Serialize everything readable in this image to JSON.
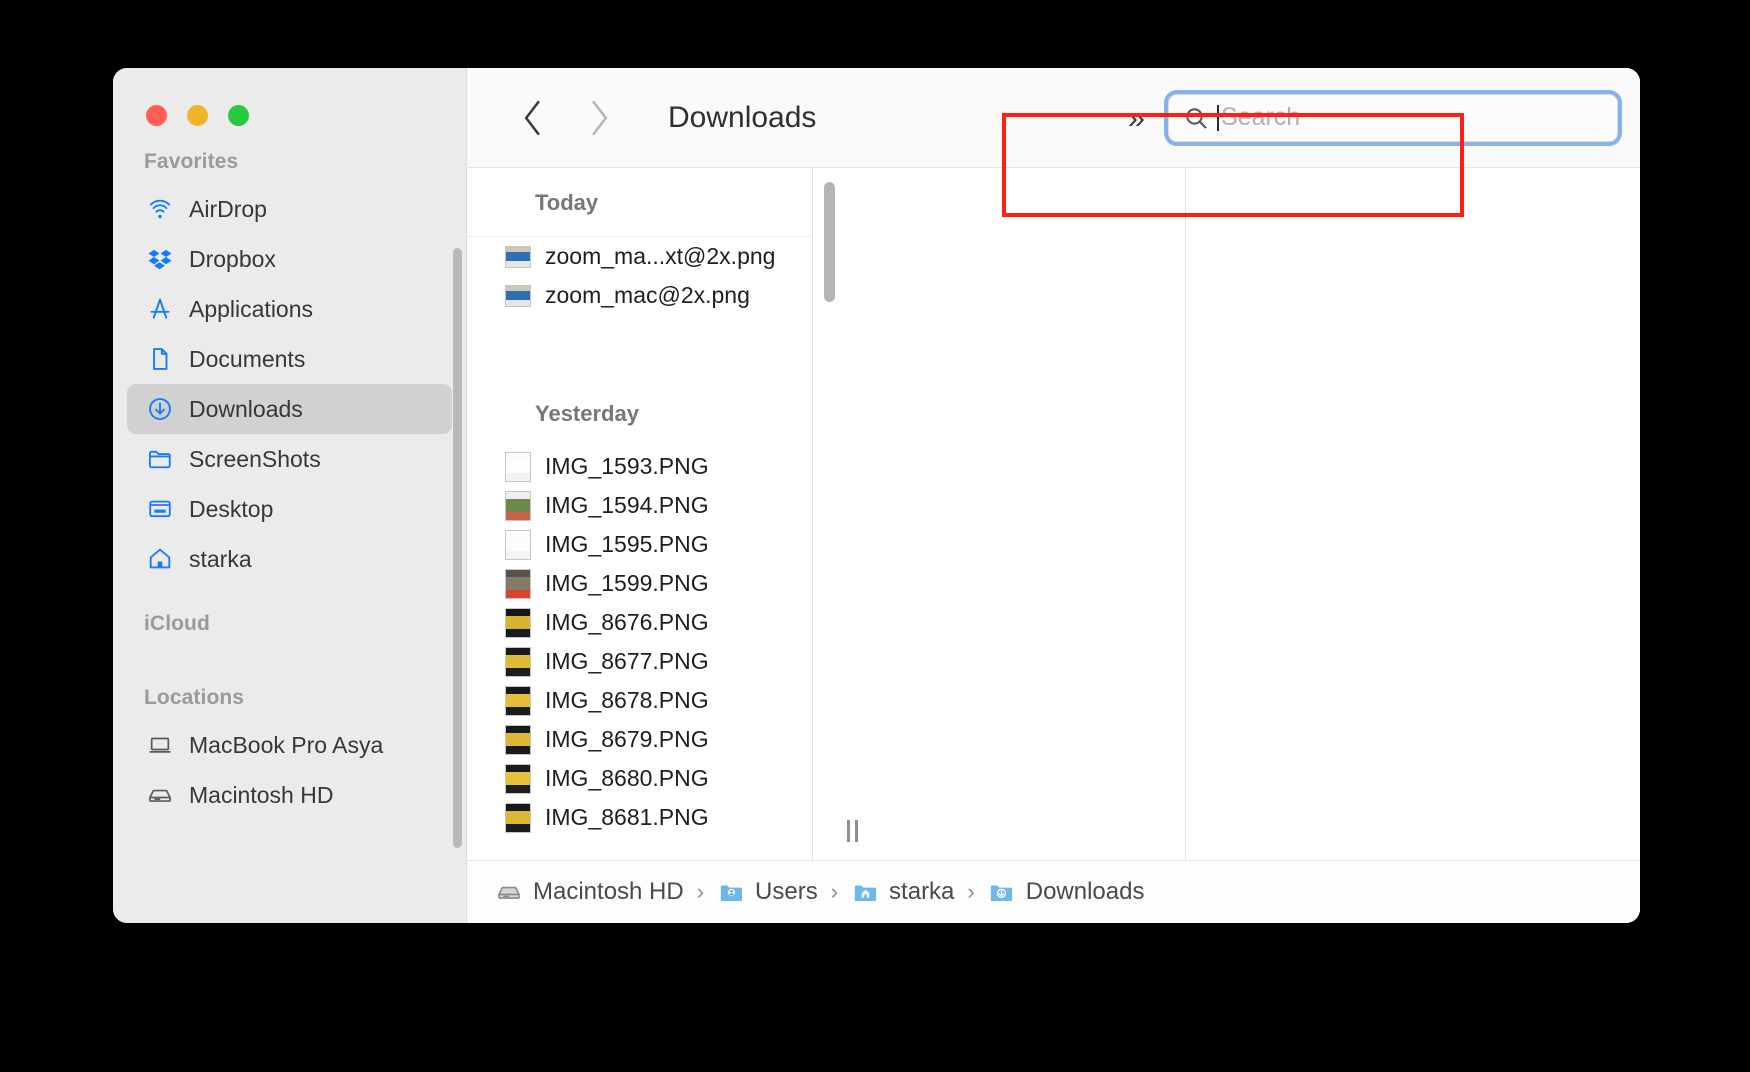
{
  "window": {
    "title": "Downloads",
    "traffic_lights": [
      {
        "name": "close",
        "color": "#ff5f57"
      },
      {
        "name": "minimize",
        "color": "#f0b429"
      },
      {
        "name": "zoom",
        "color": "#28c840"
      }
    ]
  },
  "toolbar": {
    "back_label": "‹",
    "forward_label": "›",
    "folder_title": "Downloads",
    "overflow_label": "»"
  },
  "search": {
    "placeholder": "Search",
    "value": "",
    "focused": true,
    "focus_ring_color": "#86b2ec",
    "highlight_color": "#ff2015"
  },
  "sidebar": {
    "sections": [
      {
        "label": "Favorites",
        "items": [
          {
            "label": "AirDrop",
            "icon": "airdrop-icon",
            "selected": false
          },
          {
            "label": "Dropbox",
            "icon": "dropbox-icon",
            "selected": false
          },
          {
            "label": "Applications",
            "icon": "applications-icon",
            "selected": false
          },
          {
            "label": "Documents",
            "icon": "document-icon",
            "selected": false
          },
          {
            "label": "Downloads",
            "icon": "downloads-icon",
            "selected": true
          },
          {
            "label": "ScreenShots",
            "icon": "folder-icon",
            "selected": false
          },
          {
            "label": "Desktop",
            "icon": "desktop-icon",
            "selected": false
          },
          {
            "label": "starka",
            "icon": "home-icon",
            "selected": false
          }
        ]
      },
      {
        "label": "iCloud",
        "items": []
      },
      {
        "label": "Locations",
        "items": [
          {
            "label": "MacBook Pro Asya",
            "icon": "laptop-icon",
            "selected": false
          },
          {
            "label": "Macintosh HD",
            "icon": "harddisk-icon",
            "selected": false
          }
        ]
      }
    ]
  },
  "file_list": {
    "groups": [
      {
        "label": "Today",
        "files": [
          {
            "name": "zoom_ma...xt@2x.png",
            "thumb": "landscape-screenshot",
            "colors": [
              "#d8d2c4",
              "#2f6fb5",
              "#e8e8e8"
            ]
          },
          {
            "name": "zoom_mac@2x.png",
            "thumb": "landscape-screenshot",
            "colors": [
              "#d8d2c4",
              "#2f6fb5",
              "#e8e8e8"
            ]
          }
        ]
      },
      {
        "label": "Yesterday",
        "files": [
          {
            "name": "IMG_1593.PNG",
            "thumb": "portrait-blank",
            "colors": [
              "#fbfbfb",
              "#fdfdfd",
              "#f2f2f2"
            ]
          },
          {
            "name": "IMG_1594.PNG",
            "thumb": "portrait-photo",
            "colors": [
              "#f0f0f0",
              "#6b8a4a",
              "#c9604a"
            ]
          },
          {
            "name": "IMG_1595.PNG",
            "thumb": "portrait-blank",
            "colors": [
              "#fdfdfd",
              "#fcfcfc",
              "#f4f4f4"
            ]
          },
          {
            "name": "IMG_1599.PNG",
            "thumb": "portrait-photo",
            "colors": [
              "#5a5248",
              "#847a66",
              "#d8452e"
            ]
          },
          {
            "name": "IMG_8676.PNG",
            "thumb": "portrait-photo-dark",
            "colors": [
              "#17171a",
              "#d7b531",
              "#1b1b1e"
            ]
          },
          {
            "name": "IMG_8677.PNG",
            "thumb": "portrait-photo-dark",
            "colors": [
              "#1a1a1d",
              "#e0bb35",
              "#1d1d20"
            ]
          },
          {
            "name": "IMG_8678.PNG",
            "thumb": "portrait-photo-dark",
            "colors": [
              "#19191c",
              "#e3c038",
              "#1c1c1f"
            ]
          },
          {
            "name": "IMG_8679.PNG",
            "thumb": "portrait-photo-dark",
            "colors": [
              "#18181b",
              "#dcb832",
              "#1b1b1e"
            ]
          },
          {
            "name": "IMG_8680.PNG",
            "thumb": "portrait-photo-dark",
            "colors": [
              "#1a1a1d",
              "#e6c23a",
              "#1d1d20"
            ]
          },
          {
            "name": "IMG_8681.PNG",
            "thumb": "portrait-photo-dark",
            "colors": [
              "#19191c",
              "#dcb832",
              "#1c1c1f"
            ]
          }
        ]
      }
    ]
  },
  "path_bar": {
    "crumbs": [
      {
        "label": "Macintosh HD",
        "icon": "harddisk-icon"
      },
      {
        "label": "Users",
        "icon": "users-folder-icon"
      },
      {
        "label": "starka",
        "icon": "home-folder-icon"
      },
      {
        "label": "Downloads",
        "icon": "downloads-folder-icon"
      }
    ],
    "separator": "›"
  }
}
